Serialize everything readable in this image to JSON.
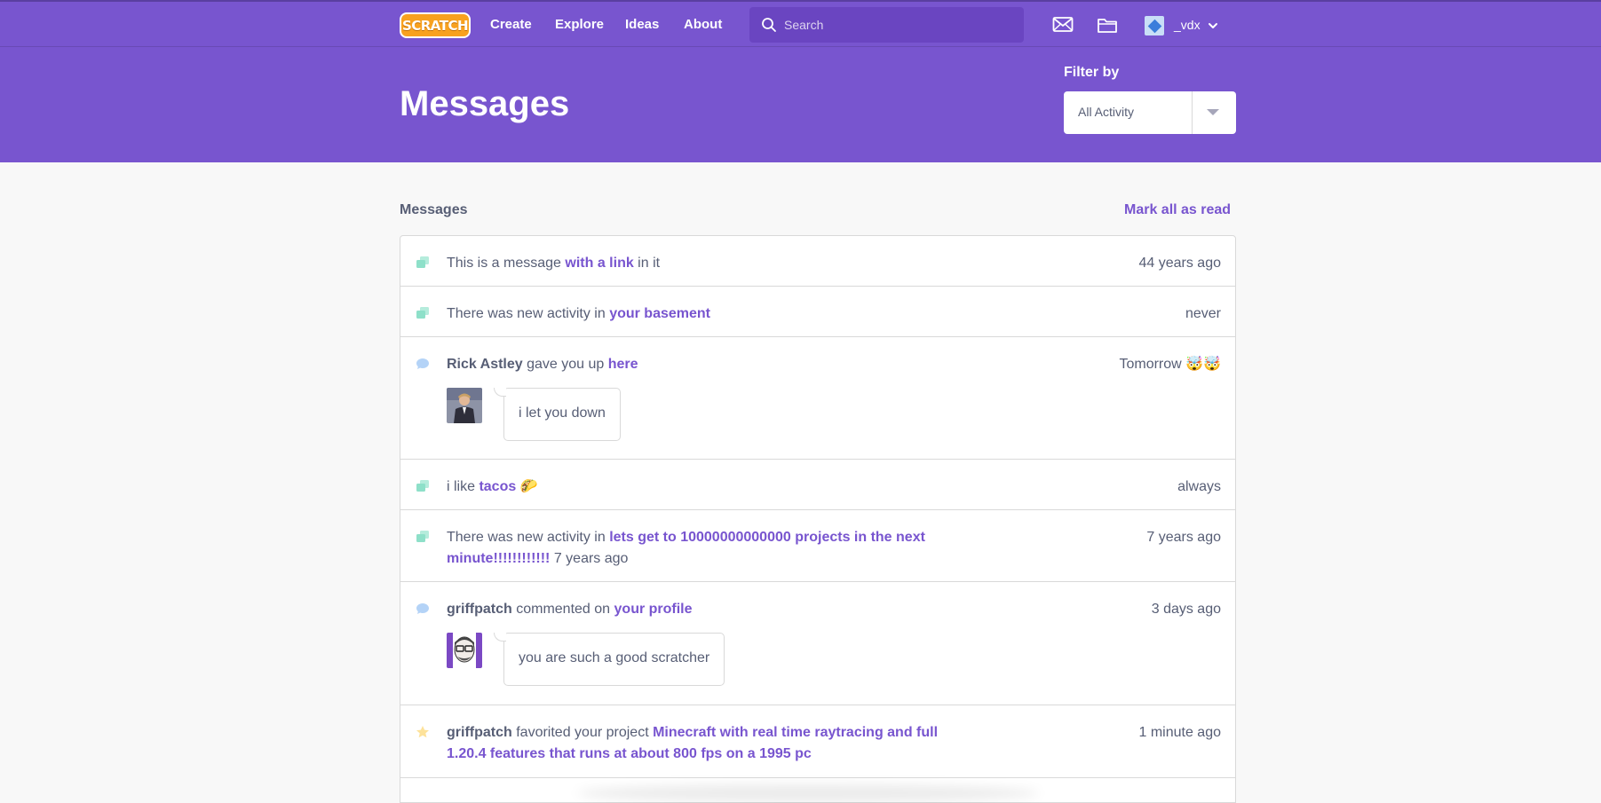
{
  "nav": {
    "logo_text": "SCRATCH",
    "links": [
      "Create",
      "Explore",
      "Ideas",
      "About"
    ],
    "search_placeholder": "Search",
    "username": "_vdx",
    "icons": [
      "messages-icon",
      "my-stuff-folder-icon"
    ]
  },
  "banner": {
    "title": "Messages",
    "filter_label": "Filter by",
    "filter_value": "All Activity"
  },
  "section": {
    "title": "Messages",
    "mark_all_read": "Mark all as read"
  },
  "messages": [
    {
      "type": "activity",
      "icon": "studio-activity-icon",
      "pre": "This is a message ",
      "link": "with a link",
      "post": " in it",
      "time": "44 years ago"
    },
    {
      "type": "activity",
      "icon": "studio-activity-icon",
      "pre": "There was new activity in ",
      "link": "your basement",
      "post": "",
      "time": "never"
    },
    {
      "type": "comment",
      "icon": "comment-icon",
      "user": "Rick Astley",
      "pre": " gave you up ",
      "link": "here",
      "time": "Tomorrow 🤯🤯",
      "comment": "i let you down"
    },
    {
      "type": "activity",
      "icon": "studio-activity-icon",
      "pre": "i like ",
      "link": "tacos",
      "post": " 🌮",
      "time": "always"
    },
    {
      "type": "activity",
      "icon": "studio-activity-icon",
      "pre": "There was new activity in ",
      "link": "lets get to 10000000000000 projects in the next minute!!!!!!!!!!!!",
      "post": " 7 years ago",
      "time": "7 years ago"
    },
    {
      "type": "comment",
      "icon": "comment-icon",
      "user": "griffpatch",
      "pre": " commented on ",
      "link": "your profile",
      "time": "3 days ago",
      "comment": "you are such a good scratcher"
    },
    {
      "type": "favorite",
      "icon": "star-icon",
      "user": "griffpatch",
      "pre": " favorited your project ",
      "link": "Minecraft with real time raytracing and full 1.20.4 features that runs at about 800 fps on a 1995 pc",
      "time": "1 minute ago"
    }
  ],
  "colors": {
    "brand_purple": "#7855cf",
    "text": "#575e75",
    "activity_icon": "#8ee0c9",
    "comment_icon": "#b4d3f7",
    "star_icon": "#fde29a"
  }
}
